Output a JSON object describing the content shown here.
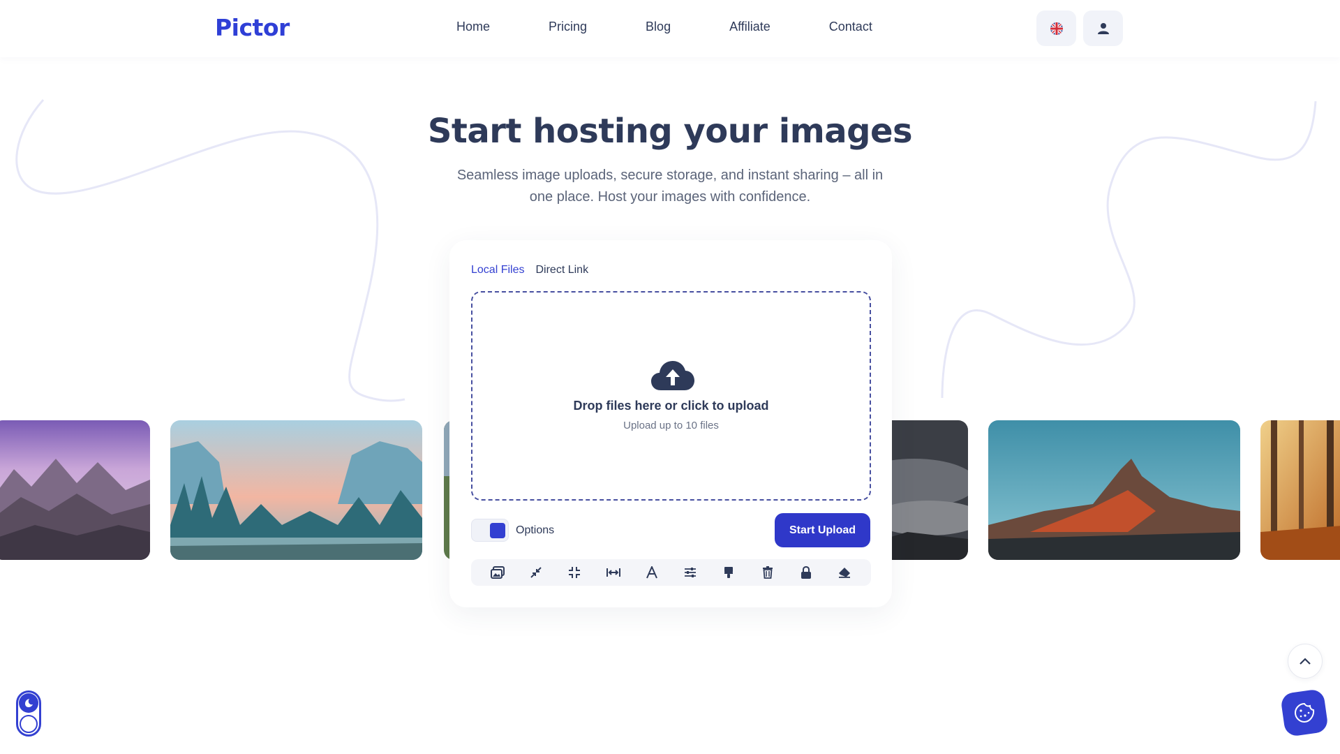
{
  "brand": {
    "logo": "Pictor",
    "accent": "#3340d1"
  },
  "nav": {
    "links": [
      "Home",
      "Pricing",
      "Blog",
      "Affiliate",
      "Contact"
    ],
    "language_icon": "uk-flag-icon",
    "account_icon": "user-icon"
  },
  "hero": {
    "title": "Start hosting your images",
    "subtitle": "Seamless image uploads, secure storage, and instant sharing – all in one place. Host your images with confidence."
  },
  "uploader": {
    "tabs": [
      {
        "label": "Local Files",
        "active": true
      },
      {
        "label": "Direct Link",
        "active": false
      }
    ],
    "dropzone": {
      "icon": "cloud-upload-icon",
      "title": "Drop files here or click to upload",
      "subtitle": "Upload up to 10 files"
    },
    "options_label": "Options",
    "start_button": "Start Upload",
    "tools": [
      "gallery-icon",
      "compress-icon",
      "crop-icon",
      "resize-width-icon",
      "text-icon",
      "adjust-sliders-icon",
      "paint-brush-icon",
      "trash-icon",
      "lock-icon",
      "eraser-icon"
    ]
  },
  "gallery": {
    "images": [
      "purple-mountains-photo",
      "misty-forest-valley-photo",
      "green-hills-photo",
      "starry-mountain-photo",
      "red-mountain-photo",
      "autumn-forest-photo"
    ]
  },
  "floating": {
    "scroll_top_icon": "chevron-up-icon",
    "theme_icon": "moon-icon",
    "cookie_icon": "cookie-icon"
  }
}
